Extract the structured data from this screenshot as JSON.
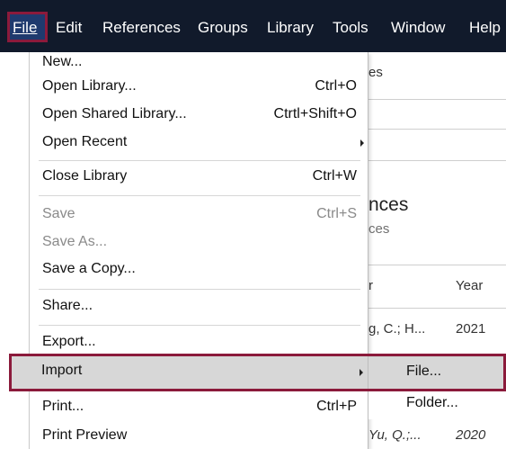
{
  "menubar": {
    "items": [
      "File",
      "Edit",
      "References",
      "Groups",
      "Library",
      "Tools",
      "Window",
      "Help"
    ]
  },
  "file_menu": {
    "items": [
      {
        "label": "New...",
        "shortcut": "",
        "disabled": false
      },
      {
        "label": "Open Library...",
        "shortcut": "Ctrl+O",
        "disabled": false
      },
      {
        "label": "Open Shared Library...",
        "shortcut": "Ctrtl+Shift+O",
        "disabled": false
      },
      {
        "label": "Open Recent",
        "shortcut": "",
        "submenu": true,
        "disabled": false
      },
      {
        "label": "Close Library",
        "shortcut": "Ctrl+W",
        "disabled": false
      },
      {
        "label": "Save",
        "shortcut": "Ctrl+S",
        "disabled": true
      },
      {
        "label": "Save As...",
        "shortcut": "",
        "disabled": true
      },
      {
        "label": "Save a Copy...",
        "shortcut": "",
        "disabled": false
      },
      {
        "label": "Share...",
        "shortcut": "",
        "disabled": false
      },
      {
        "label": "Export...",
        "shortcut": "",
        "disabled": false
      },
      {
        "label": "Import",
        "shortcut": "",
        "submenu": true,
        "disabled": false
      },
      {
        "label": "Print...",
        "shortcut": "Ctrl+P",
        "disabled": false
      },
      {
        "label": "Print Preview",
        "shortcut": "",
        "disabled": false
      }
    ]
  },
  "import_submenu": {
    "items": [
      "File...",
      "Folder..."
    ]
  },
  "background": {
    "top_fragment": "es",
    "heading_fragment": "nces",
    "subheading_fragment": "ces",
    "col_author_fragment": "r",
    "col_year": "Year",
    "row1_author": "g, C.; H...",
    "row1_year": "2021",
    "row2_author": "Yu, Q.;...",
    "row2_year": "2020"
  },
  "colors": {
    "menubar_bg": "#111a2b",
    "highlight_border": "#8b1a3b",
    "hover_bg": "#d7d7d7"
  }
}
